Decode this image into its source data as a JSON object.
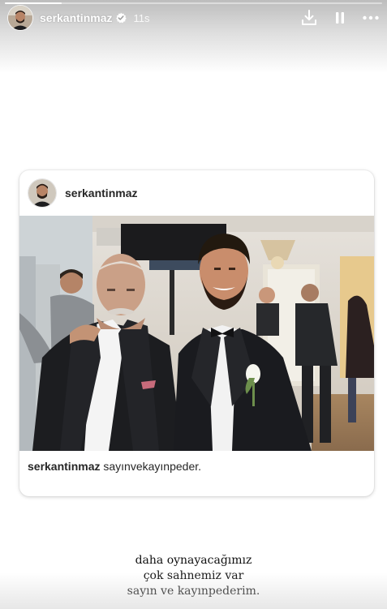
{
  "story": {
    "progress": 0.15,
    "author": {
      "username": "serkantinmaz",
      "verified": true,
      "time_ago": "11s",
      "avatar_icon": "profile-photo"
    },
    "actions": {
      "download_icon": "download-icon",
      "pause_icon": "pause-icon",
      "more_icon": "more-icon"
    }
  },
  "shared_post": {
    "username": "serkantinmaz",
    "photo": "two-men-in-suits-photo",
    "caption_username": "serkantinmaz",
    "caption_text": "sayınvekayınpeder."
  },
  "story_text": {
    "lines": [
      "daha oynayacağımız",
      "çok sahnemiz var",
      "sayın ve kayınpederim."
    ]
  },
  "colors": {
    "header_gradient_top": "#bdbdbd",
    "card_bg": "#ffffff",
    "verified_badge": "#ffffff",
    "text": "#262626"
  }
}
